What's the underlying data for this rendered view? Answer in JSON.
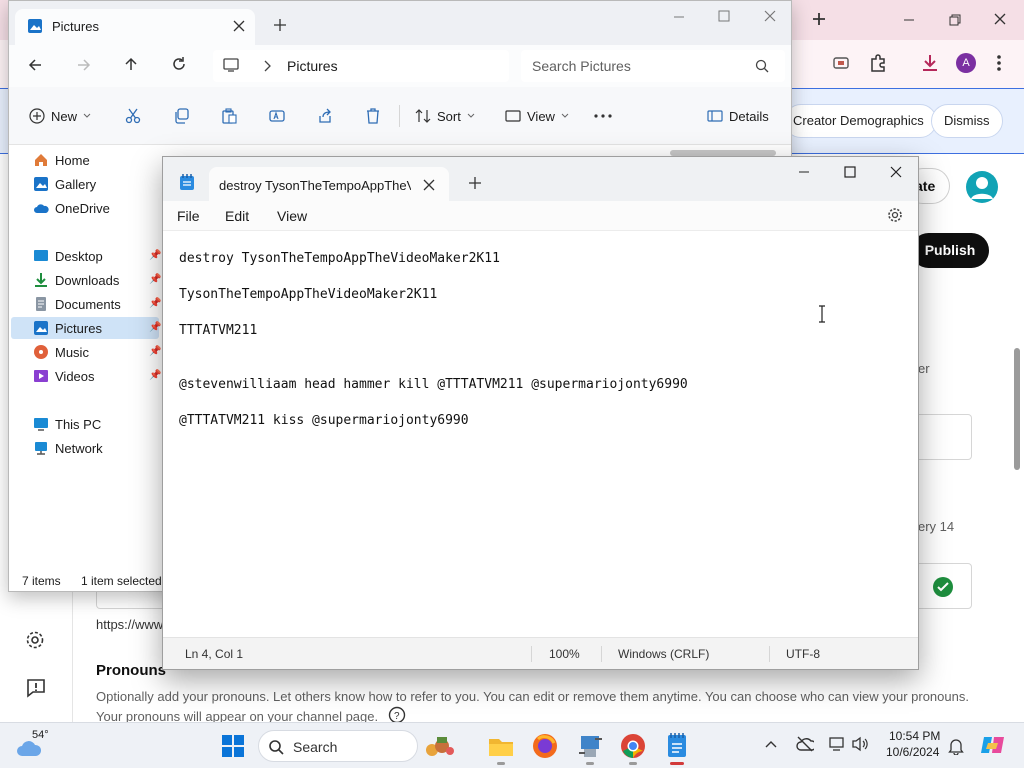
{
  "explorer": {
    "tab_title": "Pictures",
    "breadcrumb": "Pictures",
    "search_placeholder": "Search Pictures",
    "commands": {
      "new": "New",
      "sort": "Sort",
      "view": "View",
      "details": "Details"
    },
    "nav": {
      "home": "Home",
      "gallery": "Gallery",
      "onedrive": "OneDrive",
      "desktop": "Desktop",
      "downloads": "Downloads",
      "documents": "Documents",
      "pictures": "Pictures",
      "music": "Music",
      "videos": "Videos",
      "this_pc": "This PC",
      "network": "Network"
    },
    "status": {
      "items": "7 items",
      "selected": "1 item selected"
    }
  },
  "notepad": {
    "tab_title": "destroy TysonTheTempoAppTheVi",
    "menu": {
      "file": "File",
      "edit": "Edit",
      "view": "View"
    },
    "lines": [
      "destroy TysonTheTempoAppTheVideoMaker2K11",
      "TysonTheTempoAppTheVideoMaker2K11",
      "TTTATVM211",
      "@stevenwilliaam head hammer kill @TTTATVM211 @supermariojonty6990",
      "@TTTATVM211 kiss @supermariojonty6990"
    ],
    "status": {
      "position": "Ln 4, Col 1",
      "zoom": "100%",
      "line_ending": "Windows (CRLF)",
      "encoding": "UTF-8"
    }
  },
  "browser": {
    "profile_initial": "A",
    "infobar": {
      "creator_demographics": "Creator Demographics",
      "dismiss": "Dismiss"
    },
    "studio": {
      "create_partial": "ate",
      "publish": "Publish",
      "side_text_partial": "er",
      "date_partial": "ery 14",
      "url_partial": "https://www",
      "pronouns_title": "Pronouns",
      "pronouns_desc": "Optionally add your pronouns. Let others know how to refer to you. You can edit or remove them anytime. You can choose who can view your pronouns.",
      "pronouns_desc2": "Your pronouns will appear on your channel page."
    }
  },
  "taskbar": {
    "weather_temp": "54°",
    "search_label": "Search",
    "time": "10:54 PM",
    "date": "10/6/2024"
  },
  "colors": {
    "accent": "#0067c0",
    "browser_tab": "#f5dfe6",
    "publish": "#0f0f0f",
    "success": "#1e8e3e"
  }
}
